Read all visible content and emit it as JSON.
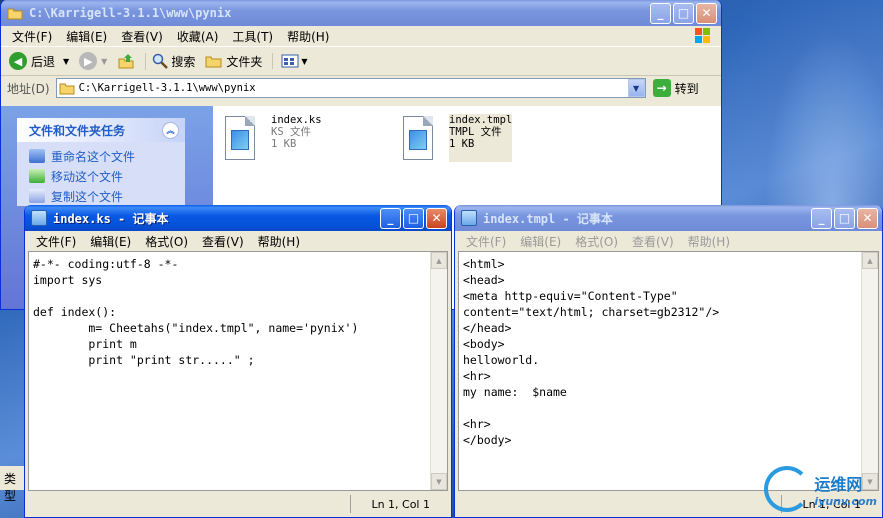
{
  "explorer": {
    "title": "C:\\Karrigell-3.1.1\\www\\pynix",
    "menu": [
      "文件(F)",
      "编辑(E)",
      "查看(V)",
      "收藏(A)",
      "工具(T)",
      "帮助(H)"
    ],
    "toolbar": {
      "back": "后退",
      "search": "搜索",
      "folders": "文件夹"
    },
    "address": {
      "label": "地址(D)",
      "value": "C:\\Karrigell-3.1.1\\www\\pynix",
      "go": "转到"
    },
    "tasks": {
      "header": "文件和文件夹任务",
      "items": [
        "重命名这个文件",
        "移动这个文件",
        "复制这个文件"
      ]
    },
    "files": [
      {
        "name": "index.ks",
        "type": "KS 文件",
        "size": "1 KB"
      },
      {
        "name": "index.tmpl",
        "type": "TMPL 文件",
        "size": "1 KB"
      }
    ],
    "status_text": "类型"
  },
  "notepad_left": {
    "title": "index.ks - 记事本",
    "menu": [
      "文件(F)",
      "编辑(E)",
      "格式(O)",
      "查看(V)",
      "帮助(H)"
    ],
    "text": "#-*- coding:utf-8 -*-\nimport sys\n\ndef index():\n        m= Cheetahs(\"index.tmpl\", name='pynix')\n        print m\n        print \"print str.....\" ;",
    "status": "Ln 1, Col 1"
  },
  "notepad_right": {
    "title": "index.tmpl - 记事本",
    "menu": [
      "文件(F)",
      "编辑(E)",
      "格式(O)",
      "查看(V)",
      "帮助(H)"
    ],
    "text": "<html>\n<head>\n<meta http-equiv=\"Content-Type\"\ncontent=\"text/html; charset=gb2312\"/>\n</head>\n<body>\nhelloworld.\n<hr>\nmy name:  $name\n\n<hr>\n</body>",
    "status": "Ln 1, Col 1"
  },
  "watermark": {
    "line1": "运维网",
    "line2": "iyunv.com"
  }
}
